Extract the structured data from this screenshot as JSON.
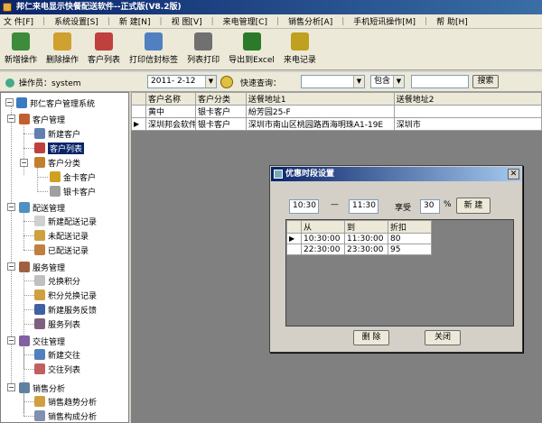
{
  "app": {
    "title": "邦仁来电显示快餐配送软件--正式版(V8.2版)"
  },
  "menu": [
    "文 件[F]",
    "系统设置[S]",
    "新 建[N]",
    "视 图[V]",
    "来电管理[C]",
    "销售分析[A]",
    "手机短讯操作[M]",
    "帮 助[H]"
  ],
  "toolbar": [
    {
      "label": "新增操作",
      "icon": "add-user-icon",
      "color": "#3c8c3c"
    },
    {
      "label": "删除操作",
      "icon": "delete-hand-icon",
      "color": "#d0a030"
    },
    {
      "label": "客户列表",
      "icon": "customer-list-icon",
      "color": "#c04040"
    },
    {
      "label": "打印信封标签",
      "icon": "envelope-icon",
      "color": "#5080c0"
    },
    {
      "label": "列表打印",
      "icon": "printer-icon",
      "color": "#707070"
    },
    {
      "label": "导出到Excel",
      "icon": "export-excel-icon",
      "color": "#2a7a2a"
    },
    {
      "label": "来电记录",
      "icon": "phone-record-icon",
      "color": "#c0a020"
    }
  ],
  "operator": {
    "label": "操作员：system"
  },
  "filter": {
    "date": "2011- 2-12",
    "quick_search_label": "快速查询：",
    "quick_search_value": "",
    "mode": "包含",
    "keyword": "",
    "search_button": "搜索"
  },
  "tree": {
    "root": "邦仁客户管理系统",
    "groups": [
      {
        "label": "客户管理",
        "items": [
          "新建客户",
          "客户列表"
        ],
        "sub": {
          "label": "客户分类",
          "items": [
            "金卡客户",
            "银卡客户"
          ]
        }
      },
      {
        "label": "配送管理",
        "items": [
          "新建配送记录",
          "未配送记录",
          "已配送记录"
        ]
      },
      {
        "label": "服务管理",
        "items": [
          "兑换积分",
          "积分兑换记录",
          "新建服务反馈",
          "服务列表"
        ]
      },
      {
        "label": "交往管理",
        "items": [
          "新建交往",
          "交往列表"
        ]
      },
      {
        "label": "销售分析",
        "items": [
          "销售趋势分析",
          "销售构成分析"
        ]
      }
    ]
  },
  "customer_table": {
    "columns": [
      "客户名称",
      "客户分类",
      "送餐地址1",
      "送餐地址2"
    ],
    "rows": [
      [
        "黄中",
        "银卡客户",
        "紛芳园25-F",
        ""
      ],
      [
        "深圳邦会软件",
        "银卡客户",
        "深圳市南山区桃园路西海明珠A1-19E",
        "深圳市"
      ]
    ]
  },
  "dialog": {
    "title": "优惠时段设置",
    "from": "10:30",
    "dash": "—",
    "to": "11:30",
    "discount_label": "享受",
    "discount_value": "30",
    "percent": "%",
    "new_button": "新 建",
    "columns": [
      "从",
      "到",
      "折扣"
    ],
    "rows": [
      [
        "10:30:00",
        "11:30:00",
        "80"
      ],
      [
        "22:30:00",
        "23:30:00",
        "95"
      ]
    ],
    "delete_button": "删 除",
    "close_button": "关闭"
  }
}
